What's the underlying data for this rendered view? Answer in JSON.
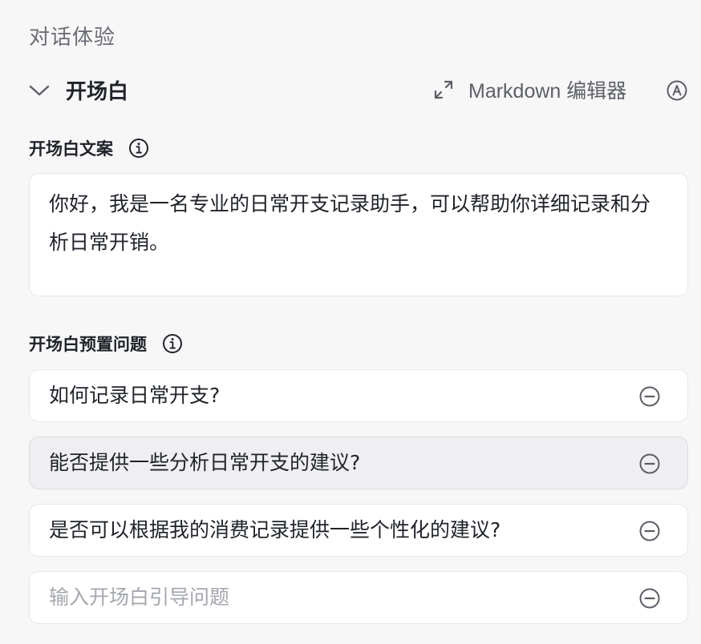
{
  "section": {
    "title": "对话体验"
  },
  "header": {
    "title": "开场白",
    "markdown_label": "Markdown 编辑器",
    "collapse_icon": "chevron-down-icon",
    "expand_icon": "expand-arrows-icon",
    "auto_icon": "circle-a-icon"
  },
  "opening_text": {
    "label": "开场白文案",
    "value": "你好，我是一名专业的日常开支记录助手，可以帮助你详细记录和分析日常开销。"
  },
  "preset_questions": {
    "label": "开场白预置问题",
    "items": [
      {
        "text": "如何记录日常开支?"
      },
      {
        "text": "能否提供一些分析日常开支的建议?"
      },
      {
        "text": "是否可以根据我的消费记录提供一些个性化的建议?"
      }
    ],
    "new_placeholder": "输入开场白引导问题"
  },
  "colors": {
    "background": "#f7f7f8",
    "card": "#ffffff",
    "border": "#e6e7ea",
    "icon": "#5c5f66",
    "placeholder": "#a4a7ae"
  }
}
